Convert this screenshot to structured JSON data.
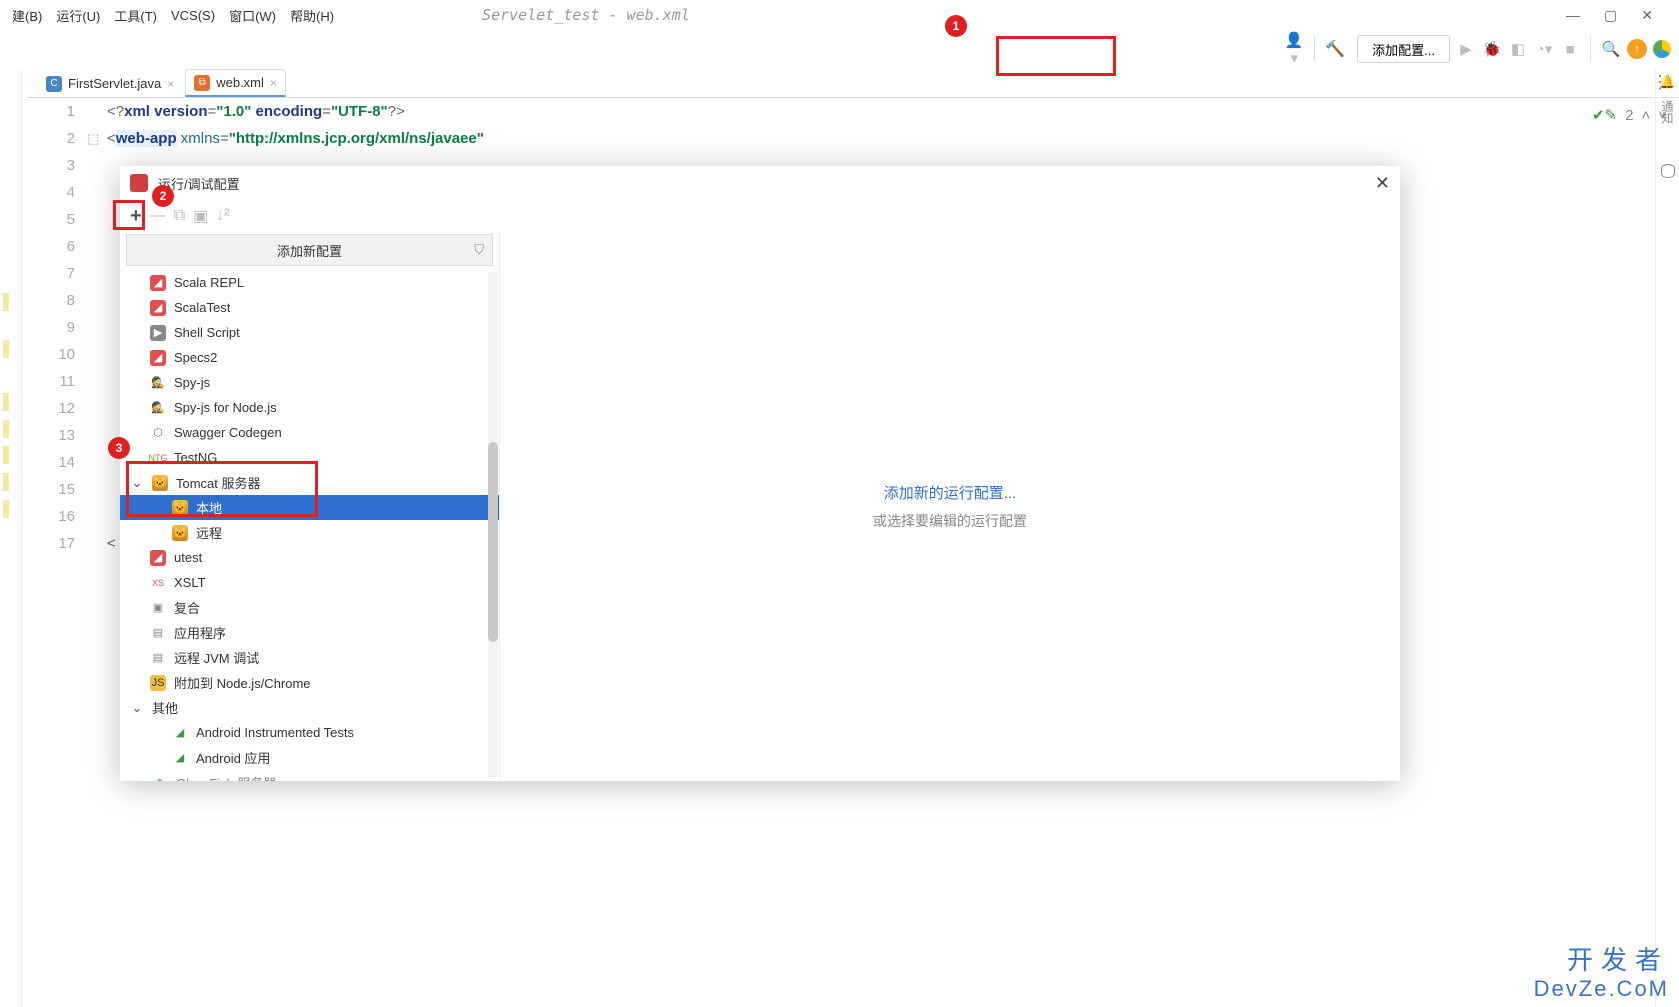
{
  "window": {
    "title": "Servelet_test - web.xml"
  },
  "menu": {
    "build": "建(B)",
    "run": "运行(U)",
    "tools": "工具(T)",
    "vcs": "VCS(S)",
    "window": "窗口(W)",
    "help": "帮助(H)"
  },
  "toolbar": {
    "add_config": "添加配置...",
    "inspections_count": "2"
  },
  "tabs": {
    "t1": "FirstServlet.java",
    "t2": "web.xml"
  },
  "code": {
    "line_numbers": [
      "1",
      "2",
      "3",
      "4",
      "5",
      "6",
      "7",
      "8",
      "9",
      "10",
      "11",
      "12",
      "13",
      "14",
      "15",
      "16",
      "17"
    ],
    "l1_a": "<?",
    "l1_b": "xml version",
    "l1_c": "=",
    "l1_d": "\"1.0\"",
    "l1_e": " encoding",
    "l1_f": "=",
    "l1_g": "\"UTF-8\"",
    "l1_h": "?>",
    "l2_a": "<",
    "l2_b": "web-app",
    "l2_c": " xmlns",
    "l2_d": "=",
    "l2_e": "\"http://xmlns.jcp.org/xml/ns/javaee\"",
    "l17": "<"
  },
  "right_tool": {
    "notif": "通知"
  },
  "dialog": {
    "title": "运行/调试配置",
    "add_header": "添加新配置",
    "tree": {
      "scala_repl": "Scala REPL",
      "scalatest": "ScalaTest",
      "shell": "Shell Script",
      "specs2": "Specs2",
      "spyjs": "Spy-js",
      "spyjs_node": "Spy-js for Node.js",
      "swagger": "Swagger Codegen",
      "testng": "TestNG",
      "tomcat": "Tomcat 服务器",
      "local": "本地",
      "remote": "远程",
      "utest": "utest",
      "xslt": "XSLT",
      "compound": "复合",
      "app": "应用程序",
      "remote_jvm": "远程 JVM 调试",
      "attach_node": "附加到 Node.js/Chrome",
      "other": "其他",
      "android_instr": "Android Instrumented Tests",
      "android_app": "Android 应用",
      "glassfish": "GlassFish 服务器"
    },
    "right": {
      "link": "添加新的运行配置...",
      "sub": "或选择要编辑的运行配置"
    }
  },
  "callouts": {
    "c1": "1",
    "c2": "2",
    "c3": "3"
  },
  "watermark": {
    "l1": "开发者",
    "l2": "DevZe.CoM"
  }
}
